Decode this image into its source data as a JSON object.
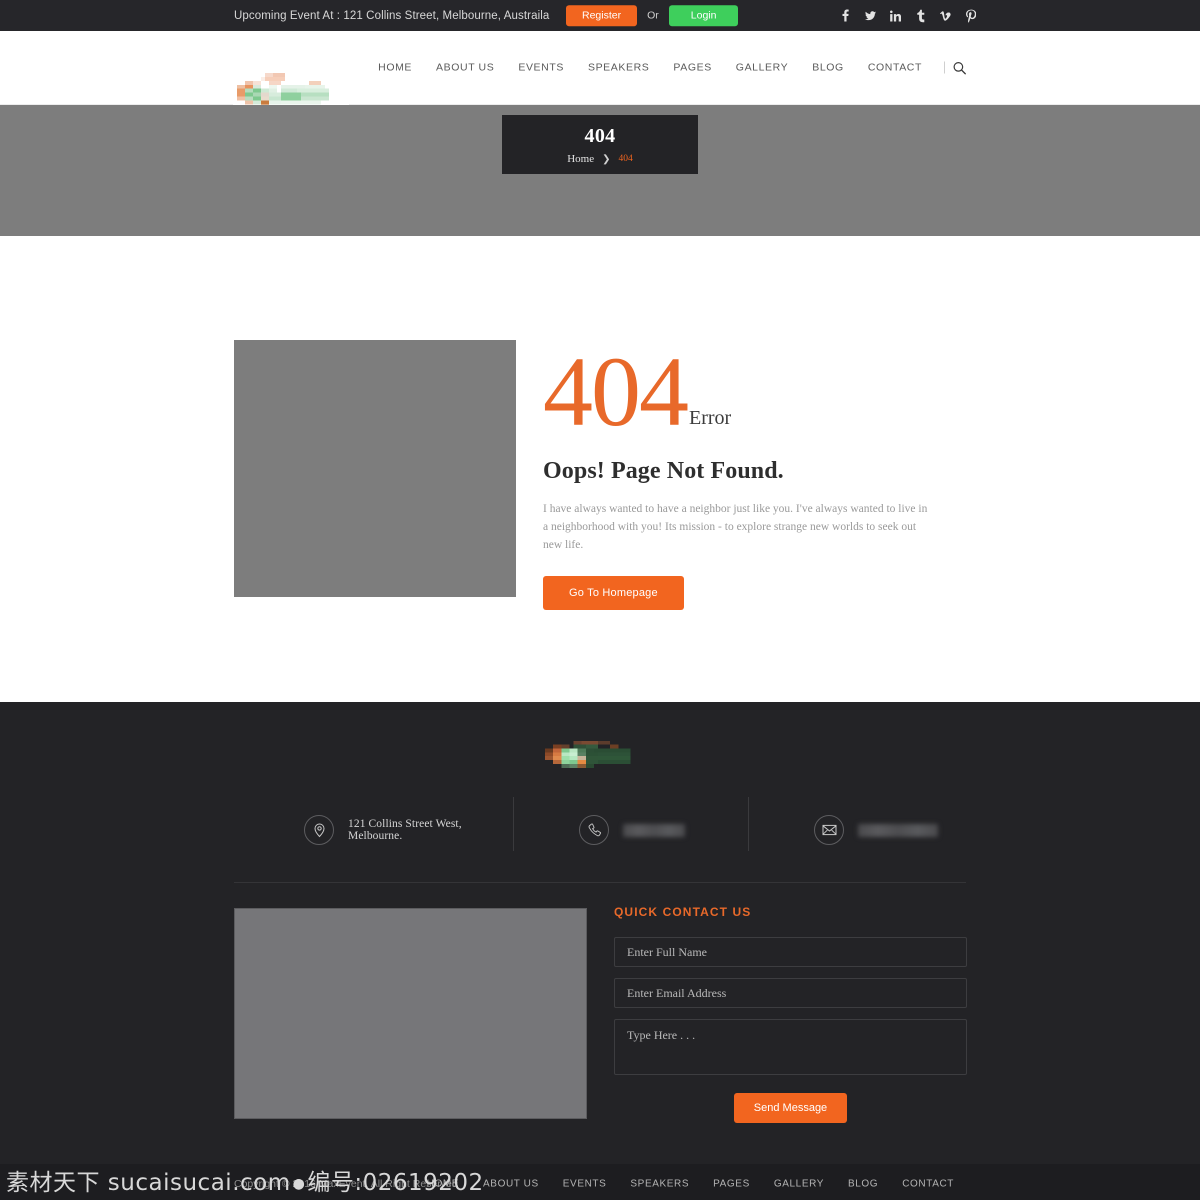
{
  "topbar": {
    "notice": "Upcoming Event At : 121 Collins Street, Melbourne, Austraila",
    "register_label": "Register",
    "or_label": "Or",
    "login_label": "Login",
    "social": [
      {
        "name": "facebook-icon",
        "glyph": "f"
      },
      {
        "name": "twitter-icon",
        "glyph": "t"
      },
      {
        "name": "linkedin-icon",
        "glyph": "in"
      },
      {
        "name": "tumblr-icon",
        "glyph": "t"
      },
      {
        "name": "vimeo-icon",
        "glyph": "v"
      },
      {
        "name": "pinterest-icon",
        "glyph": "p"
      }
    ]
  },
  "header": {
    "logo_alt": "MaxEvent",
    "nav": [
      {
        "label": "HOME"
      },
      {
        "label": "ABOUT US"
      },
      {
        "label": "EVENTS"
      },
      {
        "label": "SPEAKERS"
      },
      {
        "label": "PAGES"
      },
      {
        "label": "GALLERY"
      },
      {
        "label": "BLOG"
      },
      {
        "label": "CONTACT"
      }
    ],
    "search_icon": "search-icon"
  },
  "banner": {
    "title": "404",
    "breadcrumb_home": "Home",
    "breadcrumb_sep": "❯",
    "breadcrumb_current": "404"
  },
  "error": {
    "code": "404",
    "code_word": "Error",
    "heading": "Oops! Page Not Found.",
    "paragraph": "I have always wanted to have a neighbor just like you. I've always wanted to live in a neighborhood with you! Its mission - to explore strange new worlds to seek out new life.",
    "button_label": "Go To Homepage"
  },
  "footer": {
    "logo_alt": "MaxEvent",
    "contacts": [
      {
        "icon": "location-pin-icon",
        "text": "121 Collins Street West, Melbourne.",
        "blurred": false
      },
      {
        "icon": "phone-icon",
        "text": "",
        "blurred": true
      },
      {
        "icon": "envelope-icon",
        "text": "",
        "blurred": true
      }
    ],
    "quick_contact": {
      "title": "QUICK CONTACT US",
      "name_placeholder": "Enter Full Name",
      "name_value": "",
      "email_placeholder": "Enter Email Address",
      "email_value": "",
      "message_placeholder": "Type Here . . .",
      "message_value": "",
      "send_label": "Send Message"
    }
  },
  "bottombar": {
    "copyright": "Copyright © 2016 MaxEvent. All Right Reserved",
    "nav": [
      {
        "label": "HOME"
      },
      {
        "label": "ABOUT US"
      },
      {
        "label": "EVENTS"
      },
      {
        "label": "SPEAKERS"
      },
      {
        "label": "PAGES"
      },
      {
        "label": "GALLERY"
      },
      {
        "label": "BLOG"
      },
      {
        "label": "CONTACT"
      }
    ]
  },
  "watermark": {
    "site": "素材天下 sucaisucai.com",
    "id": "编号:02619202"
  },
  "colors": {
    "accent_orange": "#f2651f",
    "accent_green": "#3ecf5c",
    "error_orange": "#e8692a",
    "dark_bg": "#232326",
    "darker_bg": "#1d1d20",
    "banner_gray": "#7d7d7d"
  }
}
